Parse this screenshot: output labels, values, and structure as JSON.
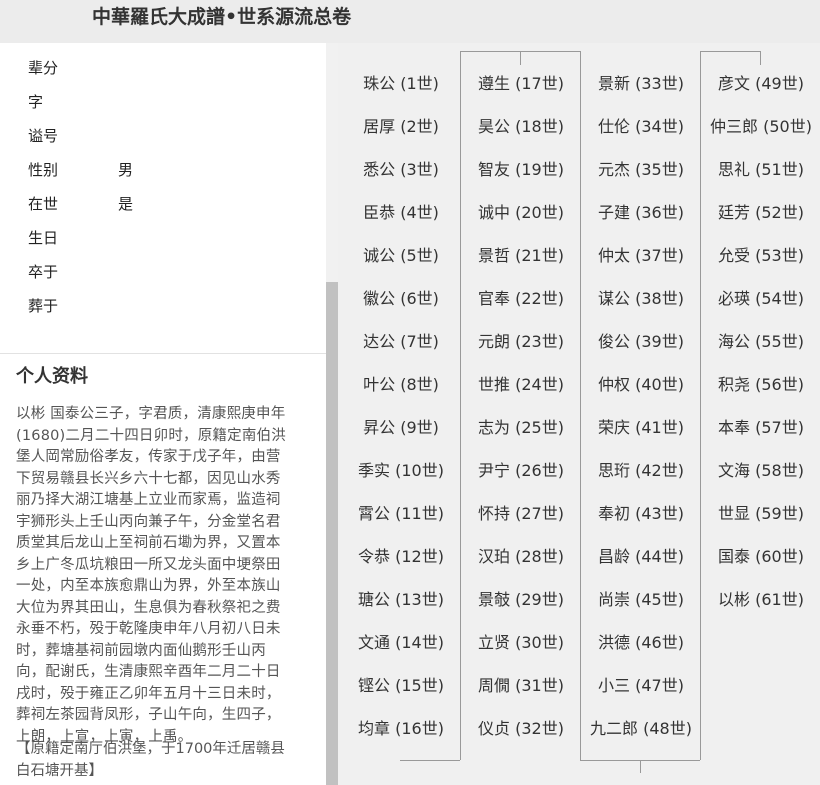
{
  "header": {
    "title": "中華羅氏大成譜•世系源流总卷"
  },
  "profile": {
    "fields": [
      {
        "label": "辈分",
        "value": ""
      },
      {
        "label": "字",
        "value": ""
      },
      {
        "label": "谥号",
        "value": ""
      },
      {
        "label": "性别",
        "value": "男"
      },
      {
        "label": "在世",
        "value": "是"
      },
      {
        "label": "生日",
        "value": ""
      },
      {
        "label": "卒于",
        "value": ""
      },
      {
        "label": "葬于",
        "value": ""
      }
    ],
    "bio_heading": "个人资料",
    "bio_text": "以彬 国泰公三子，字君质，清康熙庚申年\n(1680)二月二十四日卯时，原籍定南伯洪\n堡人岡常励俗孝友，传家于戊子年，由营\n下贸易赣县长兴乡六十七都，因见山水秀\n丽乃择大湖江塘基上立业而家焉，监造祠\n宇狮形头上壬山丙向兼子午，分金堂名君\n质堂其后龙山上至祠前石墈为界，又置本\n乡上广冬瓜坑粮田一所又龙头面中埂祭田\n一处，内至本族愈鼎山为界，外至本族山\n大位为界其田山，生息俱为春秋祭祀之费\n永垂不朽，殁于乾隆庚申年八月初八日未\n时，葬塘基祠前园墩内面仙鹅形壬山丙\n向，配谢氏，生清康熙辛酉年二月二十日\n戌时，殁于雍正乙卯年五月十三日未时，\n葬祠左茶园背凤形，子山午向，生四子，\n上朗，上宣，上寅，上禹。",
    "bio_note": "【原籍定南厅伯洪堡，于1700年迁居赣县\n白石塘开基】"
  },
  "lineage": {
    "columns": [
      [
        "珠公 (1世)",
        "居厚 (2世)",
        "悉公 (3世)",
        "臣恭 (4世)",
        "诚公 (5世)",
        "徽公 (6世)",
        "达公 (7世)",
        "叶公 (8世)",
        "昇公 (9世)",
        "季实 (10世)",
        "霄公 (11世)",
        "令恭 (12世)",
        "瑭公 (13世)",
        "文通 (14世)",
        "铿公 (15世)",
        "均章 (16世)"
      ],
      [
        "遵生 (17世)",
        "昊公 (18世)",
        "智友 (19世)",
        "诚中 (20世)",
        "景哲 (21世)",
        "官奉 (22世)",
        "元朗 (23世)",
        "世推 (24世)",
        "志为 (25世)",
        "尹宁 (26世)",
        "怀持 (27世)",
        "汉珀 (28世)",
        "景攲 (29世)",
        "立贤 (30世)",
        "周僩 (31世)",
        "仪贞 (32世)"
      ],
      [
        "景新 (33世)",
        "仕伦 (34世)",
        "元杰 (35世)",
        "子建 (36世)",
        "仲太 (37世)",
        "谋公 (38世)",
        "俊公 (39世)",
        "仲权 (40世)",
        "荣庆 (41世)",
        "思珩 (42世)",
        "奉初 (43世)",
        "昌龄 (44世)",
        "尚崇 (45世)",
        "洪德 (46世)",
        "小三 (47世)",
        "九二郎 (48世)"
      ],
      [
        "彦文 (49世)",
        "仲三郎 (50世)",
        "思礼 (51世)",
        "廷芳 (52世)",
        "允受 (53世)",
        "必瑛 (54世)",
        "海公 (55世)",
        "积尧 (56世)",
        "本奉 (57世)",
        "文海 (58世)",
        "世显 (59世)",
        "国泰 (60世)",
        "以彬 (61世)"
      ]
    ]
  },
  "colors": {
    "header_bg": "#ececec",
    "panel_bg": "#f0f0f0",
    "connector": "#999999"
  }
}
